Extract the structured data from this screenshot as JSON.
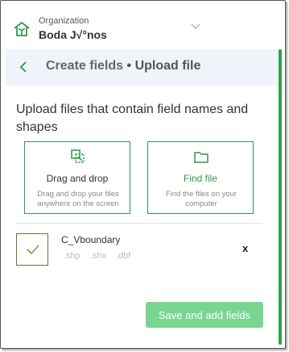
{
  "organization": {
    "label": "Organization",
    "name": "Boda J√°nos"
  },
  "title_bar": {
    "main": "Create fields",
    "separator": "•",
    "sub": "Upload file"
  },
  "heading": "Upload files that contain field names and shapes",
  "cards": {
    "drag": {
      "title": "Drag and drop",
      "description": "Drag and drop your files anywhere on the screen"
    },
    "find": {
      "title": "Find file",
      "description": "Find the files on your computer"
    }
  },
  "file": {
    "name": "C_Vboundary",
    "extensions": [
      ".shp",
      ".shx",
      ".dbf"
    ],
    "remove_label": "x"
  },
  "actions": {
    "save_label": "Save and add fields"
  },
  "colors": {
    "accent": "#2c9a48",
    "button_disabled": "#79d690",
    "title_bar_bg": "#eef4f9"
  },
  "icons": [
    "seedling-house-icon",
    "chevron-down-icon",
    "back-chevron-icon",
    "drag-drop-icon",
    "folder-icon",
    "checkmark-icon"
  ]
}
